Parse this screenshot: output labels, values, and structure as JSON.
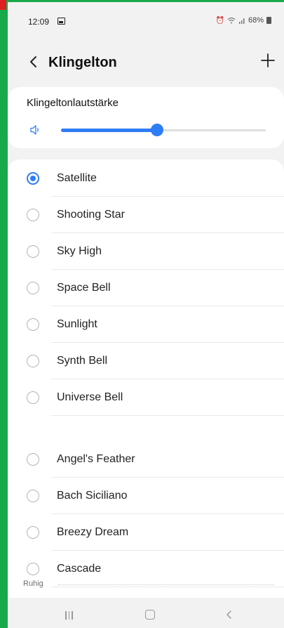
{
  "status_bar": {
    "time": "12:09",
    "battery": "68%",
    "icons": [
      "image-icon",
      "alarm-icon",
      "wifi-icon",
      "signal-icon",
      "battery-icon"
    ]
  },
  "header": {
    "title": "Klingelton"
  },
  "volume": {
    "label": "Klingeltonlautstärke",
    "level": 0.47
  },
  "ringtones": [
    {
      "label": "Satellite",
      "selected": true
    },
    {
      "label": "Shooting Star",
      "selected": false
    },
    {
      "label": "Sky High",
      "selected": false
    },
    {
      "label": "Space Bell",
      "selected": false
    },
    {
      "label": "Sunlight",
      "selected": false
    },
    {
      "label": "Synth Bell",
      "selected": false
    },
    {
      "label": "Universe Bell",
      "selected": false
    }
  ],
  "section": {
    "label": "Ruhig"
  },
  "quiet_ringtones": [
    {
      "label": "Angel's Feather",
      "selected": false
    },
    {
      "label": "Bach Siciliano",
      "selected": false
    },
    {
      "label": "Breezy Dream",
      "selected": false
    },
    {
      "label": "Cascade",
      "selected": false
    }
  ],
  "colors": {
    "accent": "#2e7cf6",
    "frame": "#18a94a",
    "background": "#f2f2f2"
  }
}
